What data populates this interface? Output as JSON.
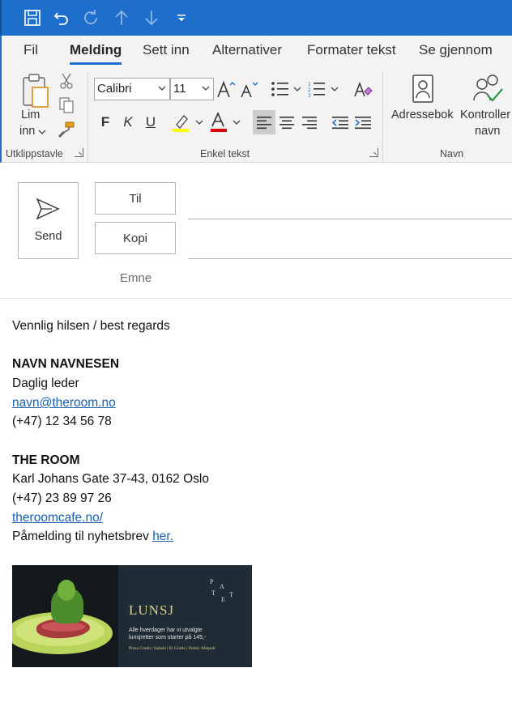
{
  "ribbon_tabs": [
    "Fil",
    "Melding",
    "Sett inn",
    "Alternativer",
    "Formater tekst",
    "Se gjennom"
  ],
  "clipboard": {
    "paste_label_1": "Lim",
    "paste_label_2": "inn",
    "group_label": "Utklippstavle"
  },
  "basic_text": {
    "font_name": "Calibri",
    "font_size": "11",
    "bold": "F",
    "italic": "K",
    "underline": "U",
    "group_label": "Enkel tekst",
    "highlight_color": "#ffff00",
    "font_color": "#e00000"
  },
  "names": {
    "address_book": "Adressebok",
    "check_names_1": "Kontroller",
    "check_names_2": "navn",
    "group_label": "Navn"
  },
  "compose": {
    "send_label": "Send",
    "to_label": "Til",
    "cc_label": "Kopi",
    "subject_label": "Emne"
  },
  "signature": {
    "greeting": "Vennlig hilsen / best regards",
    "name": "NAVN NAVNESEN",
    "title": "Daglig leder",
    "email": "navn@theroom.no",
    "phone": "(+47) 12 34 56 78",
    "company": "THE ROOM",
    "address": "Karl Johans Gate 37-43, 0162 Oslo",
    "company_phone": "(+47) 23 89 97 26",
    "website": "theroomcafe.no/",
    "newsletter_text": "Påmelding til nyhetsbrev",
    "newsletter_link": "her."
  },
  "banner": {
    "heading": "LUNSJ",
    "line1": "Alle hverdager har vi utvalgte",
    "line2": "lunsjretter som starter på 145,-",
    "venues": "Pizza Crudo | Sabaki | El Gordo | Public Matpub",
    "logo_letters": [
      "P",
      "A",
      "T",
      "E",
      "T"
    ]
  },
  "accent_color": "#1d6fcb"
}
